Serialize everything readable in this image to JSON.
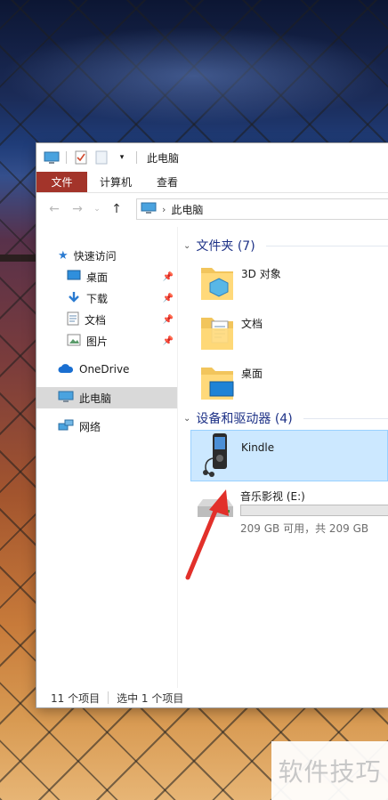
{
  "window": {
    "title": "此电脑",
    "ribbon_tabs": [
      "文件",
      "计算机",
      "查看"
    ],
    "address_path": "此电脑"
  },
  "nav": {
    "quick_access": "快速访问",
    "quick_items": [
      {
        "label": "桌面",
        "icon": "desktop-icon"
      },
      {
        "label": "下载",
        "icon": "download-icon"
      },
      {
        "label": "文档",
        "icon": "document-icon"
      },
      {
        "label": "图片",
        "icon": "picture-icon"
      }
    ],
    "onedrive": "OneDrive",
    "this_pc": "此电脑",
    "network": "网络"
  },
  "content": {
    "folders_header": "文件夹 (7)",
    "folders": [
      "3D 对象",
      "文档",
      "桌面"
    ],
    "devices_header": "设备和驱动器 (4)",
    "device_kindle": "Kindle",
    "drive_label": "音乐影视 (E:)",
    "drive_usage_fraction": 0.0,
    "drive_info": "209 GB 可用，共 209 GB"
  },
  "status": {
    "item_count": "11 个项目",
    "selected": "选中 1 个项目"
  },
  "watermark": "软件技巧",
  "colors": {
    "file_tab": "#a3342a",
    "selection": "#cce8ff",
    "group_header": "#1e3287",
    "arrow": "#e2302a"
  }
}
